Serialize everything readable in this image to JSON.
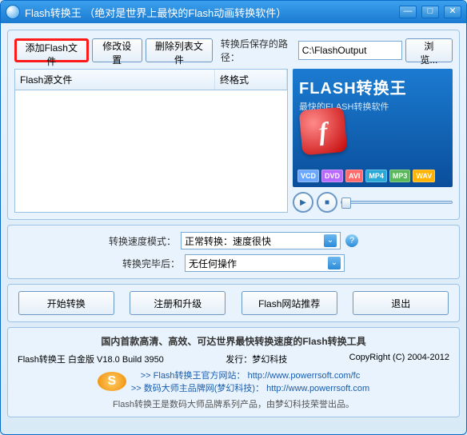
{
  "window": {
    "title": "Flash转换王 （绝对是世界上最快的Flash动画转换软件）"
  },
  "toolbar": {
    "add_flash": "添加Flash文件",
    "modify_settings": "修改设置",
    "delete_list": "删除列表文件",
    "save_path_label": "转换后保存的路径：",
    "save_path_value": "C:\\FlashOutput",
    "browse": "浏览..."
  },
  "table": {
    "col_source": "Flash源文件",
    "col_format": "终格式"
  },
  "banner": {
    "title": "FLASH转换王",
    "subtitle": "最快的FLASH转换软件",
    "badges": [
      {
        "label": "VCD",
        "color": "#6aa7ff"
      },
      {
        "label": "DVD",
        "color": "#b86aff"
      },
      {
        "label": "AVI",
        "color": "#ff6a6a"
      },
      {
        "label": "MP4",
        "color": "#2aa8d8"
      },
      {
        "label": "MP3",
        "color": "#59b859"
      },
      {
        "label": "WAV",
        "color": "#ffb300"
      }
    ]
  },
  "options": {
    "speed_label": "转换速度模式：",
    "speed_value": "正常转换：速度很快",
    "after_label": "转换完毕后：",
    "after_value": "无任何操作"
  },
  "actions": {
    "start": "开始转换",
    "register": "注册和升级",
    "recommend": "Flash网站推荐",
    "exit": "退出"
  },
  "footer": {
    "headline": "国内首款高清、高效、可达世界最快转换速度的Flash转换工具",
    "version": "Flash转换王 白金版 V18.0 Build 3950",
    "publisher_label": "发行：梦幻科技",
    "copyright": "CopyRight (C) 2004-2012",
    "link1_prefix": ">> Flash转换王官方网站：",
    "link1_url": "http://www.powerrsoft.com/fc",
    "link2_prefix": ">> 数码大师主品牌网(梦幻科技)：",
    "link2_url": "http://www.powerrsoft.com",
    "bottom_note": "Flash转换王是数码大师品牌系列产品，由梦幻科技荣誉出品。"
  }
}
